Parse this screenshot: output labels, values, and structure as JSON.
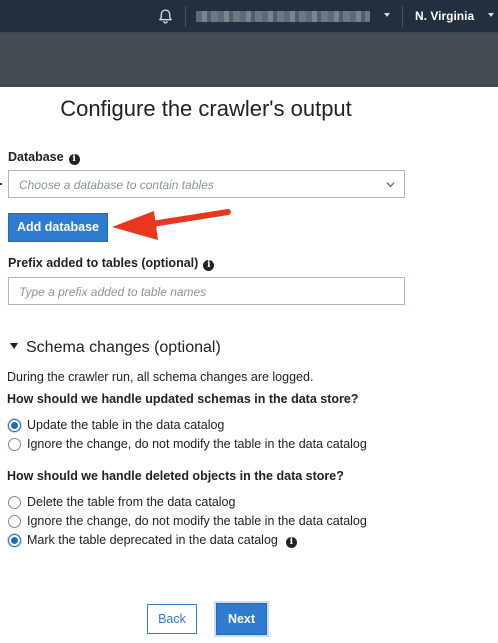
{
  "topbar": {
    "account_name": "",
    "region": "N. Virginia"
  },
  "page": {
    "title": "Configure the crawler's output"
  },
  "database": {
    "label": "Database",
    "placeholder": "Choose a database to contain tables",
    "add_button": "Add database"
  },
  "prefix": {
    "label": "Prefix added to tables (optional)",
    "placeholder": "Type a prefix added to table names"
  },
  "schema": {
    "section_title": "Schema changes (optional)",
    "description": "During the crawler run, all schema changes are logged.",
    "updated_question": "How should we handle updated schemas in the data store?",
    "updated_options": [
      {
        "label": "Update the table in the data catalog",
        "selected": true
      },
      {
        "label": "Ignore the change, do not modify the table in the data catalog",
        "selected": false
      }
    ],
    "deleted_question": "How should we handle deleted objects in the data store?",
    "deleted_options": [
      {
        "label": "Delete the table from the data catalog",
        "selected": false
      },
      {
        "label": "Ignore the change, do not modify the table in the data catalog",
        "selected": false
      },
      {
        "label": "Mark the table deprecated in the data catalog",
        "selected": true
      }
    ]
  },
  "footer": {
    "back_label": "Back",
    "next_label": "Next"
  },
  "icons": {
    "info": "info-icon",
    "bell": "bell-icon",
    "chevron": "chevron-down-icon"
  },
  "colors": {
    "topbar": "#232f3e",
    "subbar": "#444b52",
    "primary": "#2e7bcf",
    "annotation_arrow": "#e8361f"
  }
}
